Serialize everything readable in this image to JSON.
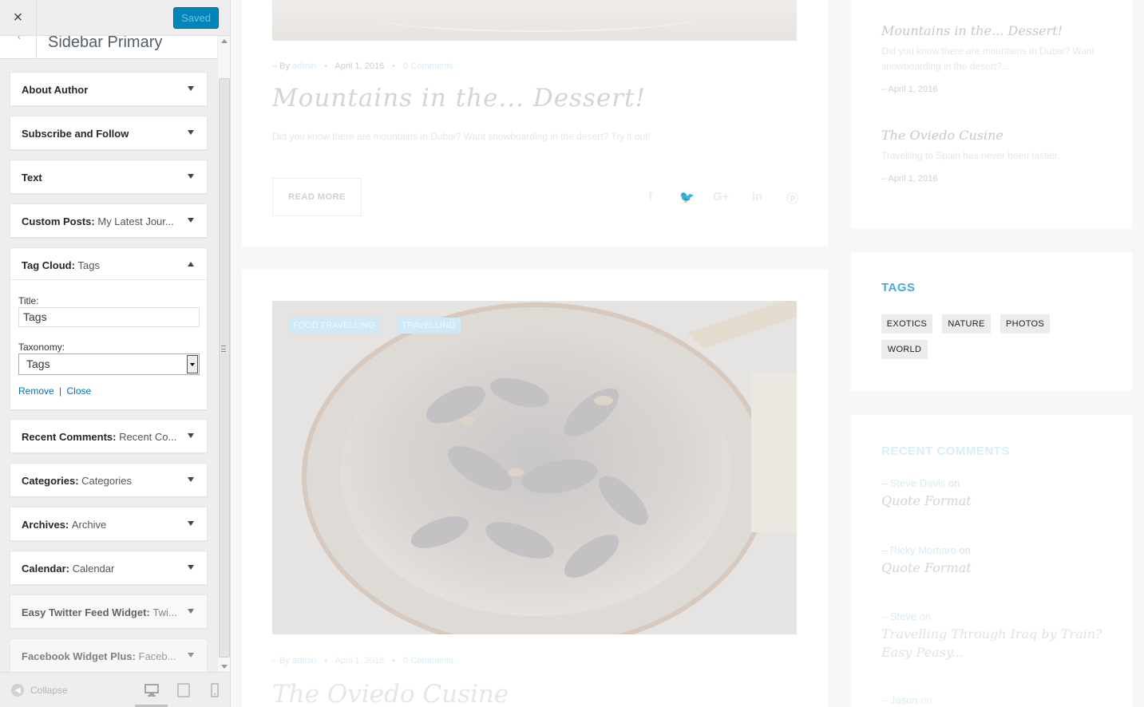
{
  "customizer": {
    "close_label": "×",
    "saved_label": "Saved",
    "section_title": "Sidebar Primary",
    "widgets": [
      {
        "title": "About Author",
        "subtitle": ""
      },
      {
        "title": "Subscribe and Follow",
        "subtitle": ""
      },
      {
        "title": "Text",
        "subtitle": ""
      },
      {
        "title": "Custom Posts:",
        "subtitle": "My Latest Jour..."
      },
      {
        "title": "Tag Cloud:",
        "subtitle": "Tags"
      },
      {
        "title": "Recent Comments:",
        "subtitle": "Recent Co..."
      },
      {
        "title": "Categories:",
        "subtitle": "Categories"
      },
      {
        "title": "Archives:",
        "subtitle": "Archive"
      },
      {
        "title": "Calendar:",
        "subtitle": "Calendar"
      },
      {
        "title": "Easy Twitter Feed Widget:",
        "subtitle": "Twi..."
      },
      {
        "title": "Facebook Widget Plus:",
        "subtitle": "Faceb..."
      }
    ],
    "tag_cloud_form": {
      "title_label": "Title:",
      "title_value": "Tags",
      "taxonomy_label": "Taxonomy:",
      "taxonomy_value": "Tags",
      "remove_label": "Remove",
      "separator": "|",
      "close_label": "Close"
    },
    "footer": {
      "collapse_label": "Collapse"
    }
  },
  "preview": {
    "post1": {
      "meta_prefix": "–  By",
      "author": "admin",
      "date": "April 1, 2016",
      "comments": "0 Comments",
      "title": "Mountains in the... Dessert!",
      "excerpt": "Did you know there are mountains in Dubai? Want snowboarding in the desert? Try it out!",
      "read_more": "READ MORE"
    },
    "post2": {
      "badges": [
        "FOOD TRAVELLING",
        "TRAVELLING"
      ],
      "meta_prefix": "–  By",
      "author": "admin",
      "date": "April 1, 2016",
      "comments": "0 Comments",
      "title": "The Oviedo Cusine"
    },
    "recent_posts": [
      {
        "title": "Mountains in the... Dessert!",
        "excerpt": "Did you know there are mountains in Dubai? Want snowboarding in the desert?...",
        "date": "–  April 1, 2016"
      },
      {
        "title": "The Oviedo Cusine",
        "excerpt": "Travelling to Spain has never been tastier.",
        "date": "–  April 1, 2016"
      }
    ],
    "tags_widget": {
      "heading": "TAGS",
      "tags": [
        "EXOTICS",
        "NATURE",
        "PHOTOS",
        "WORLD"
      ]
    },
    "recent_comments": {
      "heading": "RECENT COMMENTS",
      "items": [
        {
          "author": "Steve Davis",
          "on": "on",
          "post": "Quote Format"
        },
        {
          "author": "Ricky Mortiaro",
          "on": "on",
          "post": "Quote Format"
        },
        {
          "author": "Steve",
          "on": "on",
          "post": "Travelling Through Iraq by Train? Easy Peasy..."
        },
        {
          "author": "Jason",
          "on": "on",
          "post": ""
        }
      ]
    }
  },
  "colors": {
    "accent": "#0085ba",
    "tags_heading": "#49aadd",
    "link": "#0073aa"
  }
}
